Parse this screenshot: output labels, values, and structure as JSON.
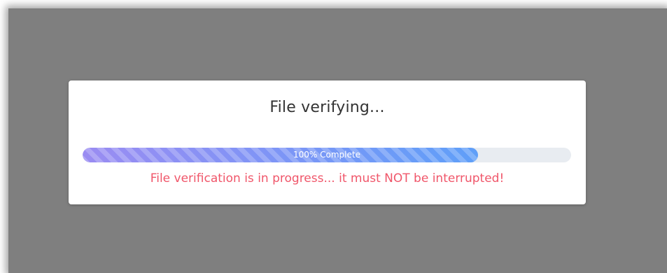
{
  "dialog": {
    "title": "File verifying...",
    "progress": {
      "percent": 0.81,
      "label": "100% Complete"
    },
    "warning": "File verification is in progress... it must NOT be interrupted!"
  },
  "colors": {
    "overlay": "#7f7f7f",
    "progress_start": "#9a8cf2",
    "progress_end": "#5f9ff8",
    "track": "#e8ecf1",
    "warning": "#f0566a"
  }
}
